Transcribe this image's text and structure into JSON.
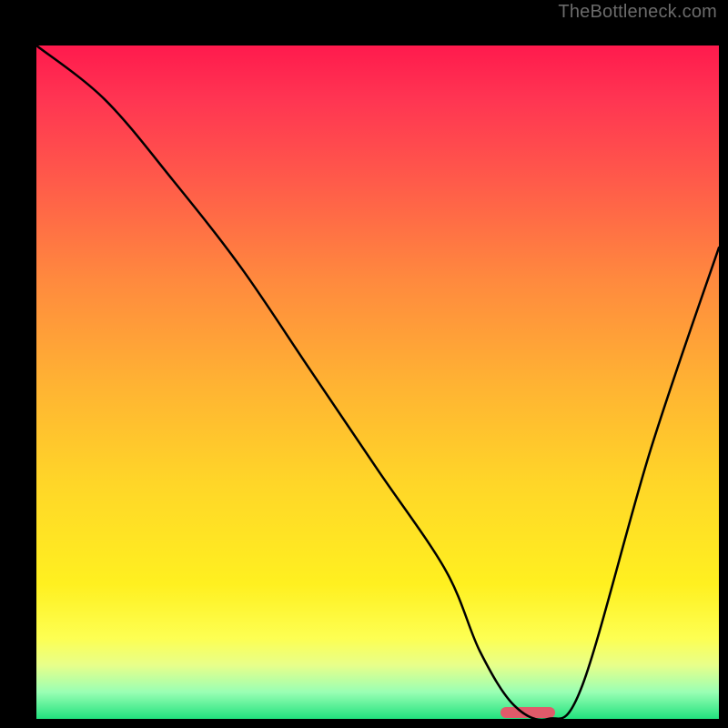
{
  "watermark": "TheBottleneck.com",
  "chart_data": {
    "type": "line",
    "title": "",
    "xlabel": "",
    "ylabel": "",
    "xlim": [
      0,
      100
    ],
    "ylim": [
      0,
      100
    ],
    "grid": false,
    "legend": false,
    "background": "red-to-green vertical gradient",
    "series": [
      {
        "name": "curve",
        "x": [
          0,
          10,
          20,
          30,
          40,
          50,
          60,
          65,
          70,
          75,
          80,
          90,
          100
        ],
        "y": [
          100,
          92,
          80,
          67,
          52,
          37,
          22,
          10,
          2,
          0,
          5,
          40,
          70
        ]
      }
    ],
    "marker": {
      "x_start": 68,
      "x_end": 76,
      "y": 1,
      "color": "#e05a6a"
    }
  }
}
